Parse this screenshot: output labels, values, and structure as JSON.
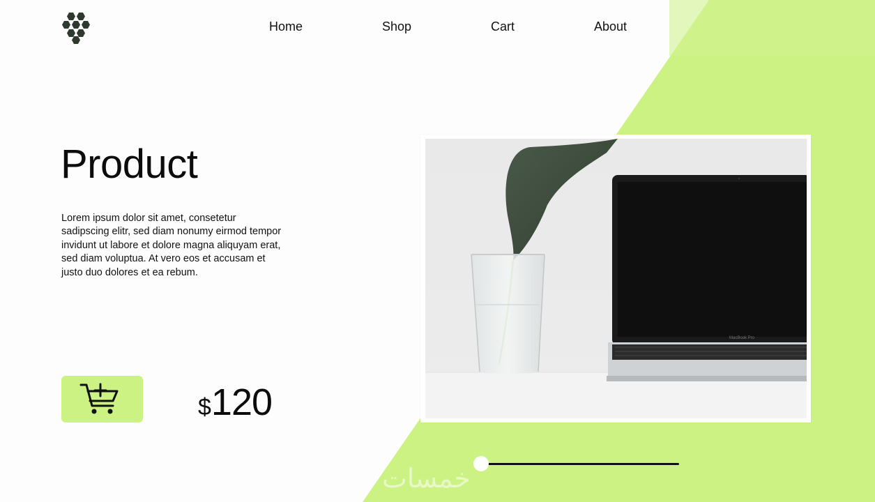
{
  "nav": {
    "items": [
      "Home",
      "Shop",
      "Cart",
      "About"
    ]
  },
  "product": {
    "title": "Product",
    "description": "Lorem ipsum dolor sit amet, consetetur sadipscing elitr, sed diam nonumy eirmod tempor invidunt ut labore et dolore magna aliquyam erat, sed diam voluptua. At vero eos et accusam et justo duo dolores et ea rebum.",
    "price_currency": "$",
    "price_amount": "120",
    "laptop_label": "MacBook Pro"
  },
  "icons": {
    "logo": "hexagon-cluster-logo-icon",
    "cart": "add-to-cart-icon"
  },
  "slider": {
    "position": 0
  },
  "watermark": "خمسات",
  "colors": {
    "accent": "#cbf282",
    "background": "#fdfdfd",
    "text": "#111111",
    "logo": "#2f3a2f"
  }
}
